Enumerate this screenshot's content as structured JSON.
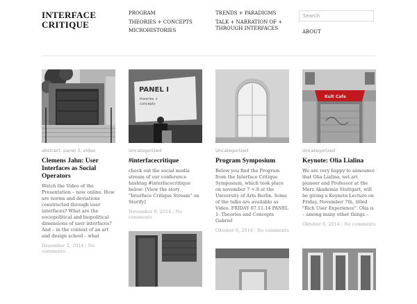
{
  "site": {
    "title_line1": "INTERFACE",
    "title_line2": "CRITIQUE"
  },
  "nav": {
    "col1": [
      "PROGRAM",
      "THEORIES + CONCEPTS",
      "MICROHISTORIES"
    ],
    "col2": [
      "TRENDS + PARADIGMS",
      "TALK + NARRATION OF + THROUGH INTERFACES"
    ],
    "search_placeholder": "Search",
    "about": "ABOUT"
  },
  "posts": [
    {
      "categories": [
        "abstract",
        "panel 3",
        "video"
      ],
      "title": "Clemens Jahn: User Interfaces as Social Operators",
      "excerpt": "Watch the Video of the Presentation – now online. How are norms and deviations constructed through user interfaces? What are the sociopolitical and biopolitical dimensions of user interfaces? And – in the context of an art and design school – what",
      "date": "Dezember 2, 2014",
      "comments": "No comments"
    },
    {
      "categories": [
        "Uncategorized"
      ],
      "title": "#interfacecritique",
      "excerpt": "check out the social media stream of our conference hashtag #interfacecritique below: [View the story \"Interface Critique Stream\" on Storify]",
      "date": "November 8, 2014",
      "comments": "No comments"
    },
    {
      "categories": [
        "Uncategorized"
      ],
      "title": "Program Symposium",
      "excerpt": "Below you find the Program from the Interface Critique Symposium, which took place on november 7 +.8 at the University of Arts Berlin. Some of the talks are available as Video. FRIDAY 07.11.14 PANEL 1: Theories and Concepts Gabriel",
      "date": "Oktober 6, 2014",
      "comments": "No comments"
    },
    {
      "categories": [
        "Uncategorized"
      ],
      "title": "Keynote: Olia Lialina",
      "excerpt": "We are very happy to announce that Olia Lialina, net.art pioneer and Professor at the Merz Akademie Stuttgart, will be giving a Keynote Lecture on Friday, November 7th, titled \"Rich User Experience\". Olia is – among many other things –",
      "date": "Oktober 6, 2014",
      "comments": "No comments"
    }
  ],
  "slide_text": {
    "line1": "PANEL I",
    "line2": "theories +",
    "line3": "concepts"
  },
  "sign_text": "Kult Cafe"
}
